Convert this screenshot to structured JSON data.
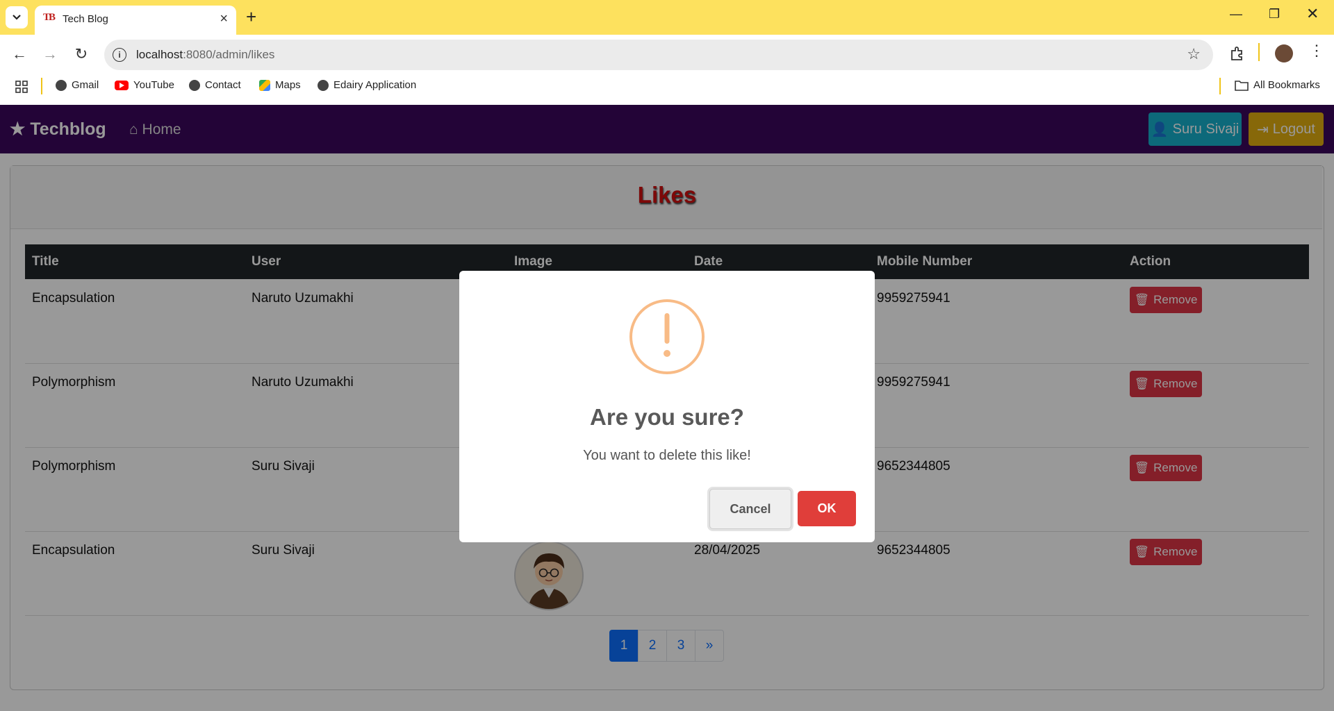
{
  "browser": {
    "tab_title": "Tech Blog",
    "tab_favicon_text": "TB",
    "url_host": "localhost",
    "url_rest": ":8080/admin/likes",
    "bookmarks": [
      "Gmail",
      "YouTube",
      "Contact",
      "Maps",
      "Edairy Application"
    ],
    "all_bookmarks": "All Bookmarks",
    "colors": {
      "tab_bar": "#fde15e"
    }
  },
  "navbar": {
    "brand": "Techblog",
    "home": "Home",
    "user_button": "Suru Sivaji",
    "logout_button": "Logout",
    "colors": {
      "background": "#3b075d",
      "user": "#16b0cc",
      "logout": "#e2ad0f"
    }
  },
  "page": {
    "title": "Likes",
    "columns": [
      "Title",
      "User",
      "Image",
      "Date",
      "Mobile Number",
      "Action"
    ],
    "rows": [
      {
        "title": "Encapsulation",
        "user": "Naruto Uzumakhi",
        "date": "",
        "mobile": "9959275941",
        "action": "Remove"
      },
      {
        "title": "Polymorphism",
        "user": "Naruto Uzumakhi",
        "date": "",
        "mobile": "9959275941",
        "action": "Remove"
      },
      {
        "title": "Polymorphism",
        "user": "Suru Sivaji",
        "date": "",
        "mobile": "9652344805",
        "action": "Remove"
      },
      {
        "title": "Encapsulation",
        "user": "Suru Sivaji",
        "date": "28/04/2025",
        "mobile": "9652344805",
        "action": "Remove"
      }
    ],
    "pagination": [
      "1",
      "2",
      "3",
      "»"
    ],
    "active_page": "1"
  },
  "dialog": {
    "icon": "warning-icon",
    "title": "Are you sure?",
    "text": "You want to delete this like!",
    "cancel": "Cancel",
    "ok": "OK",
    "colors": {
      "icon": "#f8bb86",
      "ok": "#e03e3a"
    }
  }
}
